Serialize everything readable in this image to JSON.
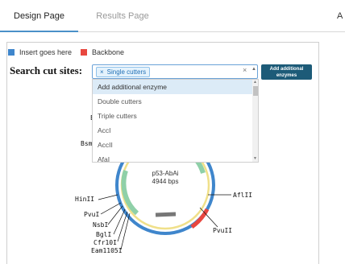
{
  "tabs": {
    "design": "Design Page",
    "results": "Results Page",
    "extra": "A"
  },
  "legend": {
    "insert": "Insert goes here",
    "backbone": "Backbone",
    "insert_color": "#3f86cc",
    "backbone_color": "#e8473f"
  },
  "search": {
    "label": "Search cut sites:",
    "chip": "Single cutters",
    "chip_remove": "×",
    "clear": "×",
    "caret": "▲"
  },
  "add_button": {
    "line1": "Add additional",
    "line2": "enzymes"
  },
  "dropdown": {
    "options": [
      "Add additional enzyme",
      "Double cutters",
      "Triple cutters",
      "AccI",
      "AccII",
      "AfaI"
    ],
    "active_index": 0
  },
  "plasmid": {
    "name": "p53-AbAi",
    "size": "4944 bps"
  },
  "enzymes": {
    "top_partial": "E",
    "bsm": "Bsm",
    "aflII": "AflII",
    "hinII": "HinII",
    "pvuI": "PvuI",
    "nsbI": "NsbI",
    "bglI": "BglI",
    "cfr10I": "Cfr10I",
    "eam1105I": "Eam1105I",
    "pvuII": "PvuII"
  }
}
